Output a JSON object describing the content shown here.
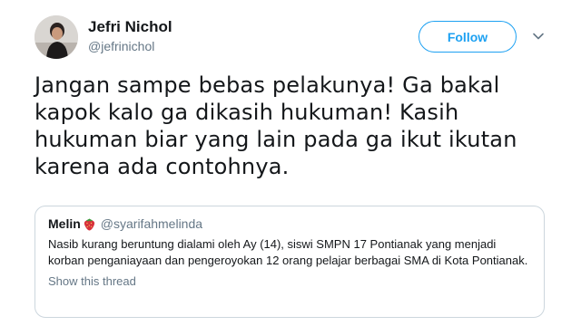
{
  "author": {
    "name": "Jefri Nichol",
    "handle": "@jefrinichol",
    "avatar_icon": "profile-photo"
  },
  "follow_label": "Follow",
  "menu_icon": "chevron-down-icon",
  "tweet_text": "Jangan sampe bebas pelakunya! Ga bakal kapok kalo ga dikasih hukuman! Kasih hukuman biar yang lain pada ga ikut ikutan karena ada contohnya.",
  "quoted": {
    "name": "Melin",
    "emoji_icon": "strawberry-icon",
    "handle": "@syarifahmelinda",
    "text": "Nasib kurang beruntung dialami oleh Ay (14), siswi SMPN 17 Pontianak yang menjadi korban penganiayaan dan pengeroyokan 12 orang pelajar berbagai SMA di Kota Pontianak.",
    "thread_link": "Show this thread"
  },
  "colors": {
    "accent": "#1da1f2",
    "text": "#14171a",
    "secondary": "#657786",
    "border": "#ccd6dd"
  }
}
